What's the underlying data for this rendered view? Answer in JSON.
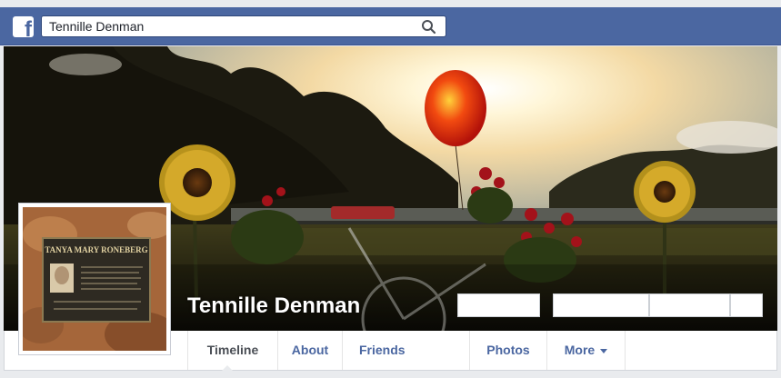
{
  "header": {
    "search_value": "Tennille Denman",
    "logo_letter": "f",
    "brand_color": "#4b67a1"
  },
  "profile": {
    "name": "Tennille Denman"
  },
  "plaque": {
    "name_text": "TANYA MARY RONEBERG"
  },
  "tabs": [
    {
      "label": "Timeline"
    },
    {
      "label": "About"
    },
    {
      "label": "Friends"
    },
    {
      "label": "Photos"
    },
    {
      "label": "More"
    }
  ]
}
